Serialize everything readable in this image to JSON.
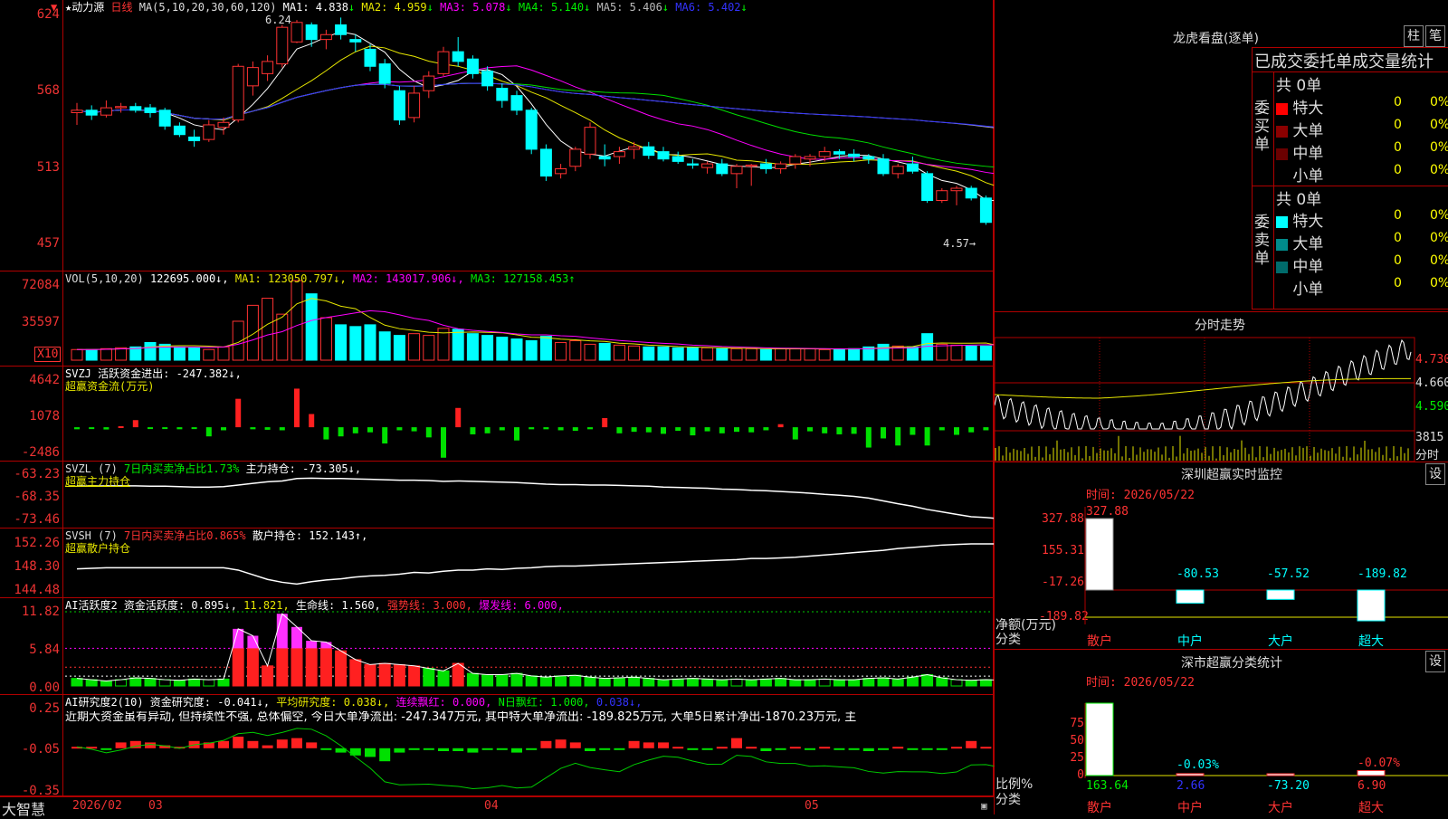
{
  "main": {
    "title": "★动力源",
    "period": "日线",
    "ma_label": "MA(5,10,20,30,60,120)",
    "ma_items": [
      {
        "text": "MA1: 4.838",
        "arrow": "↓",
        "color": "#ffffff"
      },
      {
        "text": "MA2: 4.959",
        "arrow": "↓",
        "color": "#e6e600"
      },
      {
        "text": "MA3: 5.078",
        "arrow": "↓",
        "color": "#ff00ff"
      },
      {
        "text": "MA4: 5.140",
        "arrow": "↓",
        "color": "#00e000"
      },
      {
        "text": "MA5: 5.406",
        "arrow": "↓",
        "color": "#bbbbbb"
      },
      {
        "text": "MA6: 5.402",
        "arrow": "↓",
        "color": "#3333ff"
      }
    ],
    "high_label": "6.24",
    "low_label": "4.57→",
    "y_labels": [
      "624",
      "568",
      "513",
      "457"
    ]
  },
  "vol": {
    "label": "VOL(5,10,20)",
    "value": "122695.000↓,",
    "ma1": "MA1: 123050.797↓,",
    "ma2": "MA2: 143017.906↓,",
    "ma3": "MA3: 127158.453↑",
    "y_labels": [
      "72084",
      "35597"
    ],
    "unit": "X10"
  },
  "svzj": {
    "label": "SVZJ  活跃资金进出: -247.382↓,",
    "sub": "超赢资金流(万元)",
    "y_labels": [
      "4642",
      "1078",
      "-2486"
    ]
  },
  "svzl": {
    "label": "SVZL (7)",
    "ratio": "7日内买卖净占比1.73%",
    "hold": "主力持仓: -73.305↓,",
    "sub": "超赢主力持仓",
    "y_labels": [
      "-63.23",
      "-68.35",
      "-73.46"
    ]
  },
  "svsh": {
    "label": "SVSH (7)",
    "ratio": "7日内买卖净占比0.865%",
    "hold": "散户持仓: 152.143↑,",
    "sub": "超赢散户持仓",
    "y_labels": [
      "152.26",
      "148.30",
      "144.48"
    ]
  },
  "ai_active": {
    "label": "AI活跃度2 资金活跃度: 0.895↓,",
    "v2": "11.821,",
    "v3": "生命线: 1.560,",
    "v4": "强势线: 3.000,",
    "v5": "爆发线: 6.000,",
    "y_labels": [
      "11.82",
      "5.84",
      "0.00"
    ]
  },
  "ai_research": {
    "label": "AI研究度2(10) 资金研究度: -0.041↓,",
    "avg": "平均研究度: 0.038↓,",
    "red1": "连续飘红: 0.000,",
    "red2": "N日飘红: 1.000,",
    "red3": "0.038↓,",
    "comment": "近期大资金虽有异动, 但持续性不强, 总体偏空, 今日大单净流出: -247.347万元, 其中特大单净流出: -189.825万元, 大单5日累计净出-1870.23万元, 主",
    "y_labels": [
      "0.25",
      "-0.05",
      "-0.35"
    ]
  },
  "bottom_axis": {
    "brand": "大智慧",
    "dates": [
      "2026/02",
      "03",
      "04",
      "05"
    ]
  },
  "right_top": {
    "title": "龙虎看盘(逐单)",
    "btn1": "柱",
    "btn2": "笔",
    "subtitle": "已成交委托单成交量统计",
    "buy_label": "委买单",
    "sell_label": "委卖单",
    "buy_total": "共 0单",
    "sell_total": "共 0单",
    "buy_rows": [
      {
        "name": "特大",
        "val": "0",
        "pct": "0%",
        "color": "#ff0000"
      },
      {
        "name": "大单",
        "val": "0",
        "pct": "0%",
        "color": "#8b0000"
      },
      {
        "name": "中单",
        "val": "0",
        "pct": "0%",
        "color": "#6b0000"
      },
      {
        "name": "小单",
        "val": "0",
        "pct": "0%",
        "color": ""
      }
    ],
    "sell_rows": [
      {
        "name": "特大",
        "val": "0",
        "pct": "0%",
        "color": "#00ffff"
      },
      {
        "name": "大单",
        "val": "0",
        "pct": "0%",
        "color": "#008b8b"
      },
      {
        "name": "中单",
        "val": "0",
        "pct": "0%",
        "color": "#006b6b"
      },
      {
        "name": "小单",
        "val": "0",
        "pct": "0%",
        "color": ""
      }
    ]
  },
  "intraday": {
    "title": "分时走势",
    "y_labels": [
      "4.730",
      "4.660",
      "4.590"
    ],
    "vol_label": "3815",
    "vol_unit": "分时"
  },
  "sz_monitor": {
    "title": "深圳超赢实时监控",
    "btn": "设",
    "time": "时间: 2026/05/22",
    "y_labels": [
      "327.88",
      "155.31",
      "-17.26",
      "-189.82"
    ],
    "ylabel": "净额(万元)",
    "xlabel": "分类",
    "categories": [
      "散户",
      "中户",
      "大户",
      "超大"
    ],
    "value_labels": [
      "327.88",
      "-80.53",
      "-57.52",
      "-189.82"
    ]
  },
  "sz_class": {
    "title": "深市超赢分类统计",
    "btn": "设",
    "time": "时间: 2026/05/22",
    "y_labels": [
      "75",
      "50",
      "25",
      "0"
    ],
    "ylabel": "比例%",
    "xlabel": "分类",
    "categories": [
      "散户",
      "中户",
      "大户",
      "超大"
    ],
    "top_labels": [
      "",
      "-0.03%",
      "",
      "-0.07%"
    ],
    "value_labels": [
      "163.64",
      "2.66",
      "-73.20",
      "6.90"
    ]
  },
  "chart_data": [
    {
      "type": "candlestick",
      "title": "动力源 日线",
      "ylim": [
        4.4,
        6.3
      ],
      "x_ticks": [
        "2026/02",
        "03",
        "04",
        "05"
      ],
      "ohlc": [
        [
          5.48,
          5.56,
          5.38,
          5.5
        ],
        [
          5.5,
          5.54,
          5.42,
          5.46
        ],
        [
          5.46,
          5.58,
          5.44,
          5.52
        ],
        [
          5.52,
          5.56,
          5.48,
          5.53
        ],
        [
          5.53,
          5.56,
          5.48,
          5.5
        ],
        [
          5.52,
          5.55,
          5.44,
          5.48
        ],
        [
          5.5,
          5.52,
          5.34,
          5.37
        ],
        [
          5.37,
          5.4,
          5.28,
          5.3
        ],
        [
          5.28,
          5.34,
          5.2,
          5.25
        ],
        [
          5.26,
          5.42,
          5.24,
          5.38
        ],
        [
          5.36,
          5.44,
          5.3,
          5.4
        ],
        [
          5.42,
          5.88,
          5.4,
          5.86
        ],
        [
          5.7,
          5.9,
          5.62,
          5.85
        ],
        [
          5.8,
          5.95,
          5.74,
          5.9
        ],
        [
          5.88,
          6.2,
          5.85,
          6.18
        ],
        [
          6.06,
          6.24,
          6.05,
          6.22
        ],
        [
          6.2,
          6.22,
          6.02,
          6.08
        ],
        [
          6.08,
          6.16,
          6.0,
          6.12
        ],
        [
          6.2,
          6.26,
          6.08,
          6.12
        ],
        [
          6.08,
          6.12,
          5.98,
          6.06
        ],
        [
          6.0,
          6.04,
          5.82,
          5.86
        ],
        [
          5.88,
          5.92,
          5.68,
          5.72
        ],
        [
          5.66,
          5.7,
          5.38,
          5.42
        ],
        [
          5.44,
          5.7,
          5.4,
          5.64
        ],
        [
          5.66,
          5.82,
          5.6,
          5.78
        ],
        [
          5.8,
          6.02,
          5.78,
          5.98
        ],
        [
          5.98,
          6.1,
          5.86,
          5.9
        ],
        [
          5.92,
          5.95,
          5.76,
          5.8
        ],
        [
          5.82,
          5.86,
          5.66,
          5.7
        ],
        [
          5.68,
          5.72,
          5.52,
          5.58
        ],
        [
          5.62,
          5.66,
          5.46,
          5.5
        ],
        [
          5.5,
          5.52,
          5.14,
          5.18
        ],
        [
          5.18,
          5.22,
          4.92,
          4.96
        ],
        [
          4.98,
          5.06,
          4.94,
          5.02
        ],
        [
          5.04,
          5.2,
          5.0,
          5.18
        ],
        [
          5.14,
          5.4,
          5.1,
          5.36
        ],
        [
          5.12,
          5.22,
          5.04,
          5.1
        ],
        [
          5.12,
          5.2,
          5.06,
          5.16
        ],
        [
          5.18,
          5.24,
          5.1,
          5.2
        ],
        [
          5.2,
          5.24,
          5.1,
          5.13
        ],
        [
          5.16,
          5.2,
          5.08,
          5.1
        ],
        [
          5.12,
          5.16,
          5.06,
          5.08
        ],
        [
          5.06,
          5.1,
          5.02,
          5.05
        ],
        [
          5.03,
          5.08,
          4.98,
          5.06
        ],
        [
          5.06,
          5.1,
          4.96,
          4.98
        ],
        [
          4.98,
          5.06,
          4.86,
          5.04
        ],
        [
          5.04,
          5.06,
          4.88,
          5.05
        ],
        [
          5.06,
          5.1,
          4.98,
          5.02
        ],
        [
          5.02,
          5.08,
          4.98,
          5.06
        ],
        [
          5.06,
          5.14,
          5.02,
          5.12
        ],
        [
          5.1,
          5.14,
          5.04,
          5.12
        ],
        [
          5.12,
          5.2,
          5.08,
          5.16
        ],
        [
          5.16,
          5.18,
          5.1,
          5.14
        ],
        [
          5.14,
          5.18,
          5.08,
          5.12
        ],
        [
          5.12,
          5.14,
          5.06,
          5.1
        ],
        [
          5.1,
          5.14,
          4.96,
          4.98
        ],
        [
          4.98,
          5.06,
          4.94,
          5.04
        ],
        [
          5.06,
          5.12,
          4.98,
          5.0
        ],
        [
          4.98,
          5.0,
          4.74,
          4.76
        ],
        [
          4.76,
          4.86,
          4.74,
          4.84
        ],
        [
          4.84,
          4.88,
          4.72,
          4.86
        ],
        [
          4.86,
          4.88,
          4.76,
          4.78
        ],
        [
          4.78,
          4.8,
          4.56,
          4.58
        ],
        [
          4.62,
          4.74,
          4.57,
          4.72
        ]
      ]
    },
    {
      "type": "bar",
      "title": "VOL(5,10,20)",
      "ylim": [
        0,
        90000
      ],
      "values": [
        12000,
        12000,
        13000,
        14000,
        15000,
        20000,
        18000,
        15000,
        14000,
        12000,
        15000,
        44000,
        62000,
        70000,
        52000,
        90000,
        75000,
        48000,
        40000,
        38000,
        40000,
        32000,
        28000,
        30000,
        28000,
        36000,
        35000,
        30000,
        28000,
        26000,
        24000,
        22000,
        27000,
        20000,
        22000,
        18000,
        19000,
        17000,
        16000,
        15000,
        15000,
        14000,
        14000,
        14000,
        13000,
        13000,
        13000,
        12000,
        13000,
        13000,
        13000,
        12000,
        12000,
        13000,
        15000,
        18000,
        16000,
        15000,
        30000,
        18000,
        17000,
        16000,
        16000,
        13000
      ]
    },
    {
      "type": "bar",
      "title": "SVZJ 活跃资金进出",
      "ylim": [
        -2486,
        4642
      ],
      "values": [
        -200,
        -180,
        -220,
        100,
        700,
        -160,
        -120,
        -200,
        -180,
        -900,
        -300,
        2800,
        -200,
        -250,
        -300,
        3800,
        1300,
        -1200,
        -900,
        -600,
        -500,
        -1600,
        -300,
        -400,
        -1000,
        -3000,
        1900,
        -700,
        -600,
        -300,
        -1300,
        -200,
        -200,
        -300,
        -350,
        -200,
        900,
        -600,
        -450,
        -500,
        -650,
        -350,
        -800,
        -400,
        -600,
        -450,
        -500,
        -300,
        300,
        -1200,
        -400,
        -600,
        -700,
        -650,
        -2000,
        -1100,
        -1800,
        -750,
        -1800,
        -300,
        -750,
        -500,
        -300,
        -150
      ]
    },
    {
      "type": "line",
      "title": "SVZL 主力持仓",
      "ylim": [
        -73.46,
        -63.23
      ],
      "values": [
        -65.2,
        -65.3,
        -65.2,
        -65.2,
        -65.2,
        -65.3,
        -65.3,
        -65.4,
        -65.5,
        -65.5,
        -65.4,
        -65.0,
        -64.6,
        -64.2,
        -64.0,
        -63.4,
        -63.3,
        -63.4,
        -63.4,
        -63.5,
        -63.6,
        -63.7,
        -63.8,
        -63.8,
        -63.9,
        -64.1,
        -64.0,
        -64.1,
        -64.2,
        -64.3,
        -64.4,
        -64.6,
        -64.8,
        -64.9,
        -64.9,
        -65.0,
        -65.0,
        -65.1,
        -65.2,
        -65.3,
        -65.5,
        -65.6,
        -65.7,
        -65.8,
        -66.0,
        -66.1,
        -66.3,
        -66.4,
        -66.6,
        -66.8,
        -67.0,
        -67.3,
        -67.5,
        -67.8,
        -68.2,
        -68.9,
        -69.6,
        -70.2,
        -71.0,
        -71.6,
        -72.2,
        -72.8,
        -73.0,
        -73.3
      ]
    },
    {
      "type": "line",
      "title": "SVSH 散户持仓",
      "ylim": [
        144.48,
        152.26
      ],
      "values": [
        147.8,
        147.9,
        148.0,
        148.0,
        148.0,
        148.0,
        148.0,
        148.0,
        148.0,
        148.0,
        148.0,
        147.6,
        146.8,
        146.0,
        145.5,
        145.2,
        145.6,
        145.9,
        146.1,
        146.4,
        146.6,
        146.7,
        146.9,
        147.2,
        147.1,
        147.4,
        147.6,
        147.6,
        147.8,
        147.7,
        147.9,
        148.0,
        148.2,
        148.3,
        148.3,
        148.4,
        148.5,
        148.6,
        148.7,
        148.8,
        148.9,
        149.0,
        149.1,
        149.2,
        149.3,
        149.4,
        149.6,
        149.6,
        149.7,
        149.8,
        150.0,
        150.2,
        150.4,
        150.6,
        150.8,
        151.0,
        151.3,
        151.5,
        151.7,
        151.9,
        152.0,
        152.1,
        152.1,
        152.1
      ]
    },
    {
      "type": "bar",
      "title": "AI活跃度2 资金活跃度",
      "ylim": [
        0,
        11.82
      ],
      "values": [
        1.2,
        1.0,
        0.8,
        1.0,
        1.3,
        1.2,
        1.0,
        0.9,
        1.1,
        1.0,
        1.1,
        9.1,
        8.0,
        3.2,
        11.5,
        9.4,
        7.2,
        7.0,
        5.6,
        4.2,
        3.4,
        3.6,
        3.4,
        3.2,
        2.8,
        2.4,
        3.6,
        2.0,
        1.8,
        1.8,
        2.0,
        1.6,
        1.4,
        1.6,
        1.7,
        1.4,
        1.2,
        1.3,
        1.4,
        1.2,
        1.0,
        1.1,
        1.2,
        1.1,
        1.0,
        1.1,
        1.0,
        1.1,
        1.2,
        1.0,
        1.0,
        1.1,
        1.0,
        1.0,
        1.2,
        1.3,
        1.1,
        1.4,
        1.8,
        1.3,
        1.0,
        0.9,
        1.0,
        0.9
      ]
    },
    {
      "type": "bar",
      "title": "AI研究度2(10)",
      "ylim": [
        -0.35,
        0.25
      ],
      "values": [
        -0.02,
        -0.02,
        -0.03,
        0.01,
        0.02,
        0.01,
        -0.01,
        -0.02,
        0.02,
        0.01,
        0.02,
        0.05,
        0.02,
        -0.01,
        0.03,
        0.04,
        0.01,
        -0.03,
        -0.06,
        -0.08,
        -0.09,
        -0.12,
        -0.06,
        -0.04,
        -0.04,
        -0.05,
        -0.05,
        -0.06,
        -0.04,
        -0.03,
        -0.06,
        -0.04,
        0.02,
        0.03,
        0.01,
        -0.05,
        -0.04,
        -0.04,
        0.02,
        0.01,
        0.01,
        -0.02,
        -0.04,
        -0.04,
        -0.02,
        0.04,
        -0.02,
        -0.05,
        -0.03,
        -0.02,
        -0.04,
        -0.02,
        -0.03,
        -0.03,
        -0.05,
        -0.04,
        -0.02,
        -0.03,
        -0.03,
        -0.04,
        -0.02,
        0.02,
        -0.02,
        -0.04
      ]
    },
    {
      "type": "bar",
      "title": "深圳超赢实时监控",
      "categories": [
        "散户",
        "中户",
        "大户",
        "超大"
      ],
      "values": [
        327.88,
        -80.53,
        -57.52,
        -189.82
      ],
      "ylim": [
        -189.82,
        327.88
      ],
      "ylabel": "净额(万元)",
      "xlabel": "分类"
    },
    {
      "type": "bar",
      "title": "深市超赢分类统计",
      "categories": [
        "散户",
        "中户",
        "大户",
        "超大"
      ],
      "values": [
        163.64,
        2.66,
        -73.2,
        6.9
      ],
      "ylim": [
        0,
        100
      ],
      "ylabel": "比例%",
      "xlabel": "分类"
    }
  ]
}
